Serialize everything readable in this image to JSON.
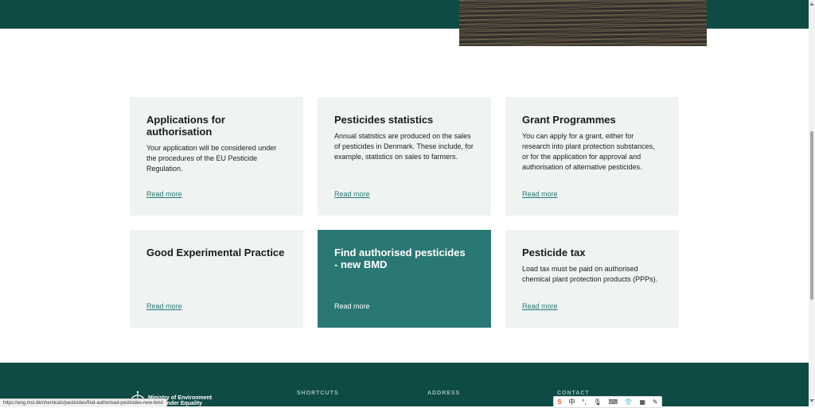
{
  "cards": [
    {
      "title": "Applications for authorisation",
      "description": "Your application will be considered under the procedures of the EU Pesticide Regulation.",
      "link_label": "Read more"
    },
    {
      "title": "Pesticides statistics",
      "description": "Annual statistics are produced on the sales of pesticides in Denmark. These include, for example, statistics on sales to farmers.",
      "link_label": "Read more"
    },
    {
      "title": "Grant Programmes",
      "description": "You can apply for a grant, either for research into plant protection substances, or for the application for approval and authorisation of alternative pesticides.",
      "link_label": "Read more"
    },
    {
      "title": "Good Experimental Practice",
      "description": "",
      "link_label": "Read more"
    },
    {
      "title": "Find authorised pesticides - new BMD",
      "description": "",
      "link_label": "Read more"
    },
    {
      "title": "Pesticide tax",
      "description": "Load tax must be paid on authorised chemical plant protection products (PPPs).",
      "link_label": "Read more"
    }
  ],
  "footer": {
    "logo_line1": "Ministry of Environment",
    "logo_line2": "and Gender Equality",
    "shortcuts_heading": "SHORTCUTS",
    "address_heading": "ADDRESS",
    "contact_heading": "CONTACT"
  },
  "status_bar": {
    "url": "https://eng.mst.dk/chemicals/pesticides/find-authorised-pesticides-new-bmd"
  },
  "ime_toolbar": {
    "items": [
      "S",
      "中",
      "°,",
      "🎙",
      "⌨",
      "👕",
      "▦",
      "✎"
    ]
  },
  "colors": {
    "header_footer": "#0f4b45",
    "card_bg": "#eff3f2",
    "card_featured_bg": "#2a7874",
    "link": "#2a7874"
  }
}
